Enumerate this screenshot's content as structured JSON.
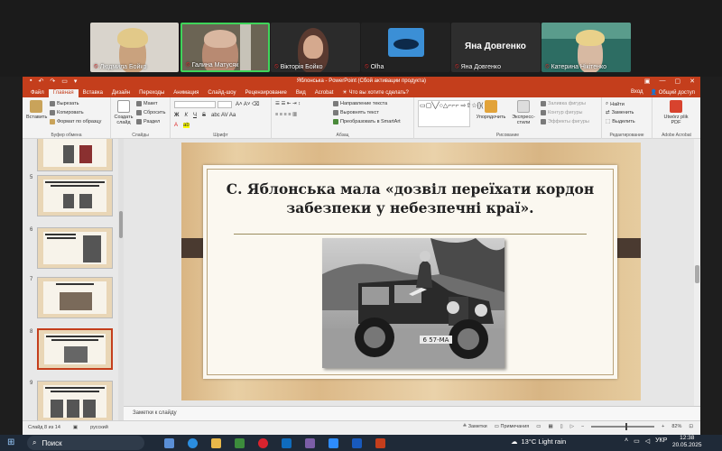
{
  "zoom": {
    "participants": [
      {
        "name": "Людмила Бойко",
        "muted": true
      },
      {
        "name": "Галина Матусяк",
        "muted": true
      },
      {
        "name": "Вікторія Бойко",
        "muted": true
      },
      {
        "name": "Olha",
        "muted": true
      },
      {
        "name": "Яна Довгенко",
        "muted": true
      },
      {
        "name": "Катерина Нікітенко",
        "muted": true
      }
    ],
    "center_name": "Яна Довгенко"
  },
  "window": {
    "title": "Яблонська - PowerPoint (Сбой активации продукта)",
    "controls": [
      "—",
      "▢",
      "✕"
    ]
  },
  "ribbon_tabs": [
    "Файл",
    "Главная",
    "Вставка",
    "Дизайн",
    "Переходы",
    "Анимация",
    "Слайд-шоу",
    "Рецензирование",
    "Вид",
    "Acrobat"
  ],
  "tell_me": "Что вы хотите сделать?",
  "signin": "Вход",
  "share": "Общий доступ",
  "ribbon": {
    "clipboard": {
      "paste": "Вставить",
      "cut": "Вырезать",
      "copy": "Копировать",
      "format": "Формат по образцу",
      "label": "Буфер обмена"
    },
    "slides": {
      "new": "Создать слайд",
      "layout": "Макет",
      "reset": "Сбросить",
      "section": "Раздел",
      "label": "Слайды"
    },
    "font": {
      "label": "Шрифт"
    },
    "paragraph": {
      "direction": "Направление текста",
      "align": "Выровнять текст",
      "smartart": "Преобразовать в SmartArt",
      "label": "Абзац"
    },
    "drawing": {
      "arrange": "Упорядочить",
      "styles": "Экспресс-стили",
      "fill": "Заливка фигуры",
      "outline": "Контур фигуры",
      "effects": "Эффекты фигуры",
      "label": "Рисование"
    },
    "editing": {
      "find": "Найти",
      "replace": "Заменить",
      "select": "Выделить",
      "label": "Редактирование"
    },
    "acrobat": {
      "pdf": "Utwórz plik PDF",
      "label": "Adobe Acrobat"
    }
  },
  "thumbnails": [
    {
      "num": "",
      "selected": false
    },
    {
      "num": "5",
      "selected": false
    },
    {
      "num": "6",
      "selected": false
    },
    {
      "num": "7",
      "selected": false
    },
    {
      "num": "8",
      "selected": true
    },
    {
      "num": "9",
      "selected": false
    }
  ],
  "slide": {
    "title": "С. Яблонська мала «дозвіл переїхати кордон забезпеки у небезпечні краї».",
    "plate": "6 57-MA"
  },
  "notes_placeholder": "Заметки к слайду",
  "status": {
    "slide_info": "Слайд 8 из 14",
    "language": "русский",
    "notes": "Заметки",
    "comments": "Примечания",
    "zoom": "82%"
  },
  "taskbar": {
    "search": "Поиск",
    "weather": "13°C  Light rain",
    "lang": "УКР",
    "time": "12:38",
    "date": "20.05.2025"
  },
  "colors": {
    "accent": "#c43e1c",
    "taskbar": "#1f2a38"
  }
}
